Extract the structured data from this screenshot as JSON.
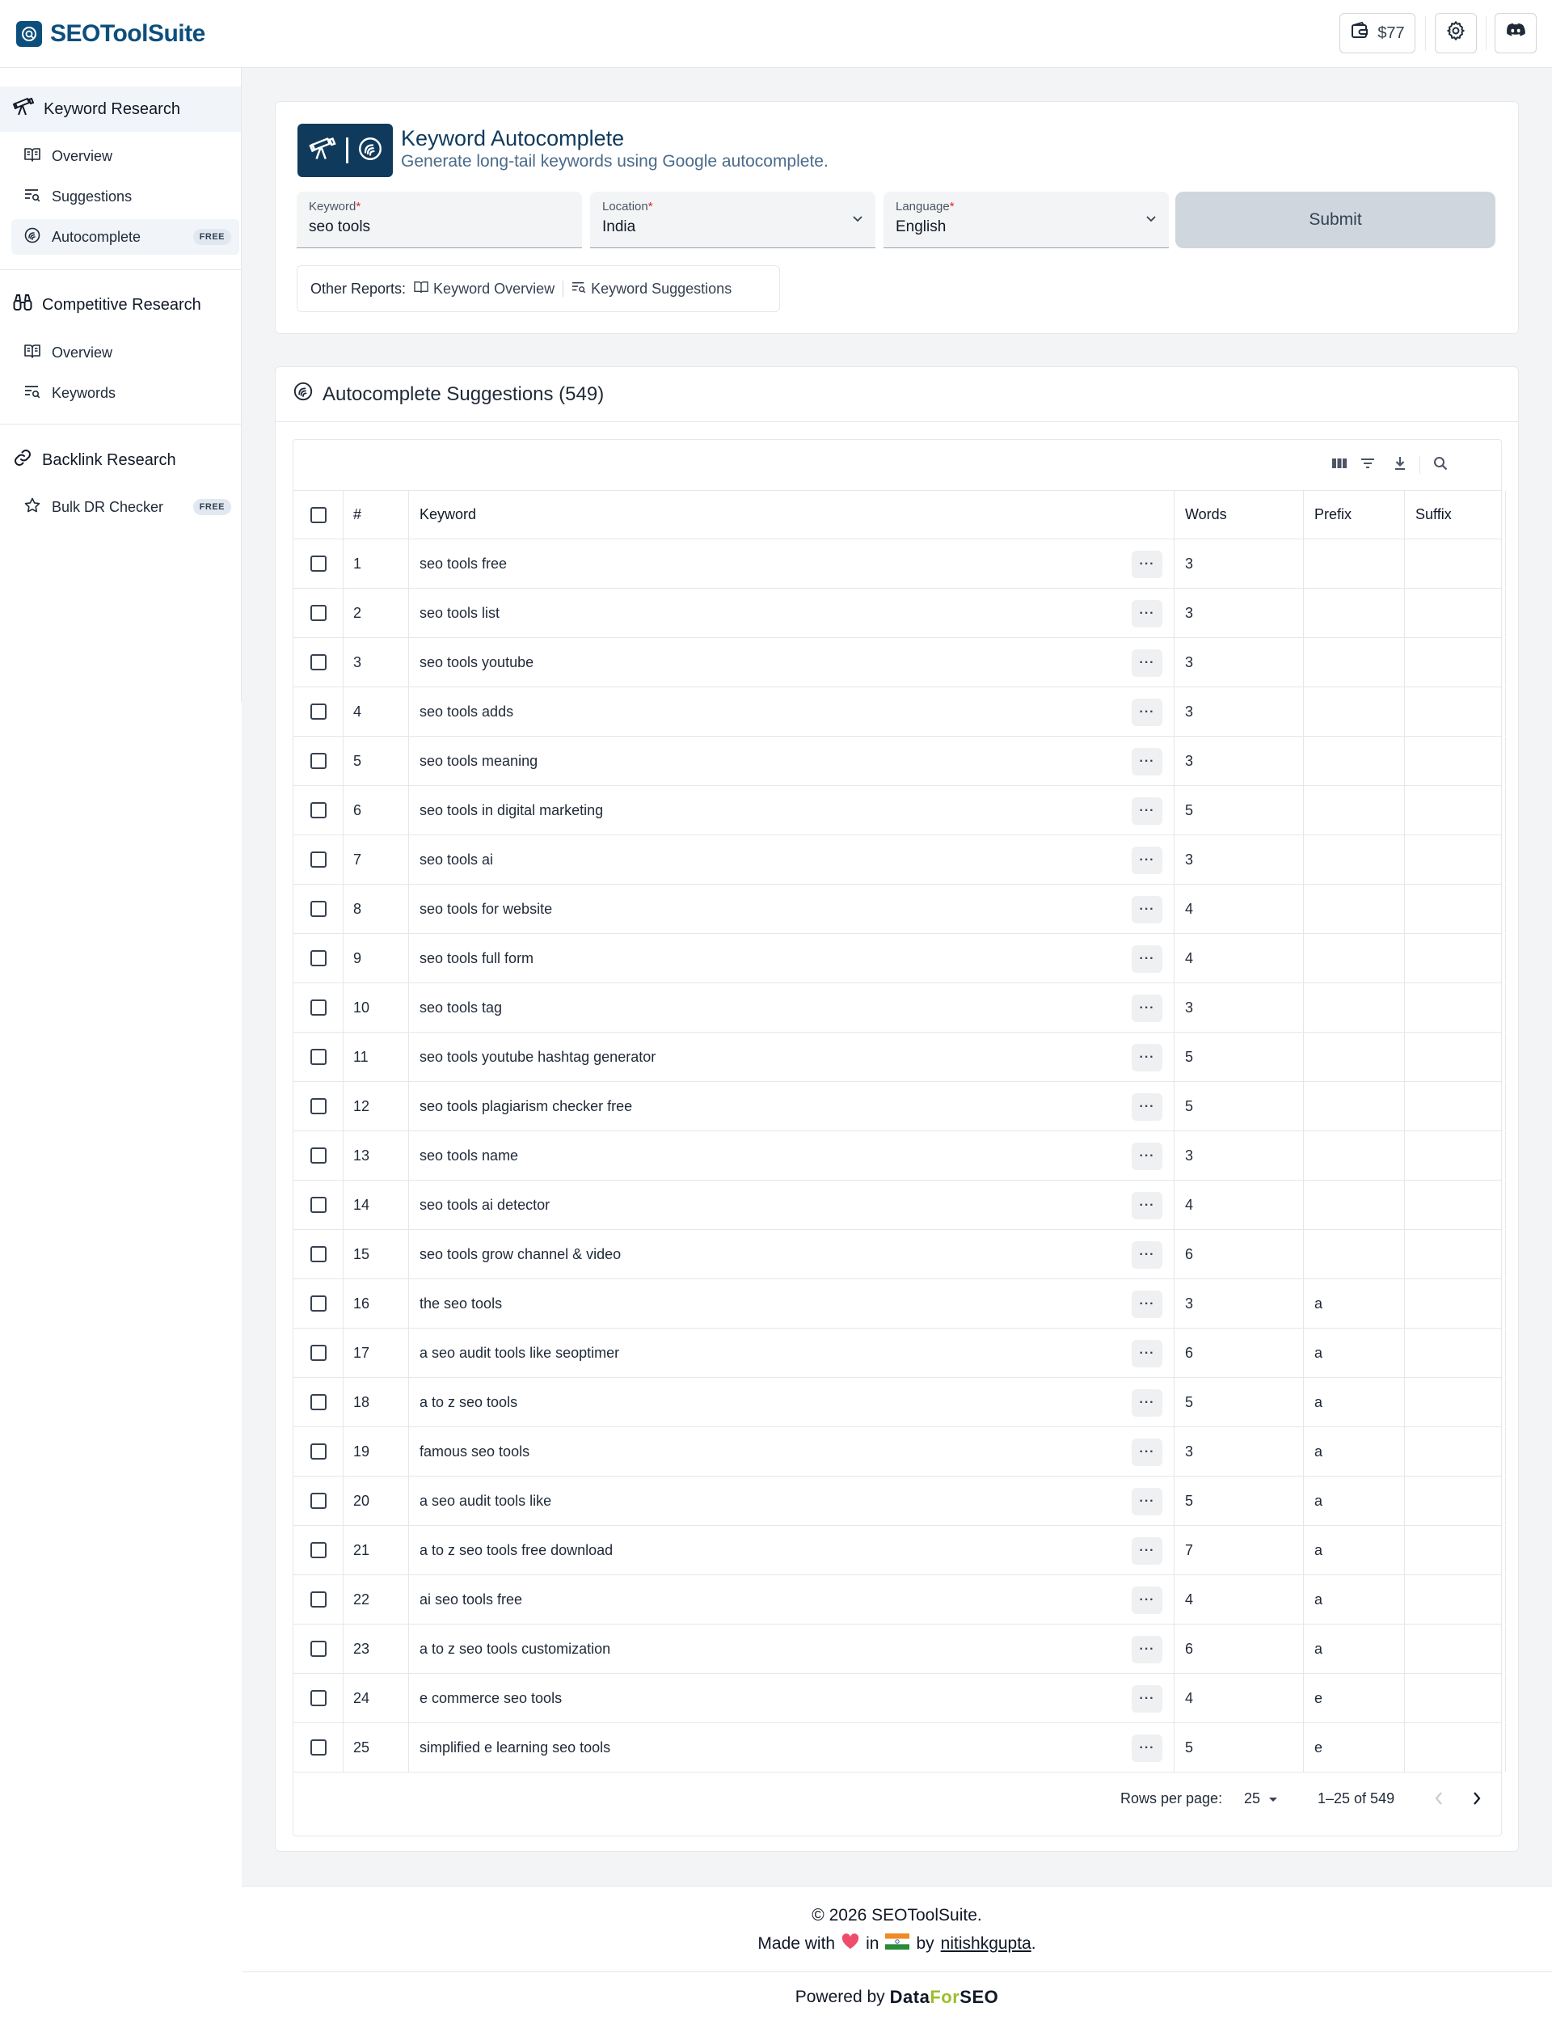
{
  "header": {
    "brand": "SEOToolSuite",
    "wallet_amount": "$77"
  },
  "sidebar": {
    "groups": [
      {
        "label": "Keyword Research",
        "items": [
          {
            "label": "Overview"
          },
          {
            "label": "Suggestions"
          },
          {
            "label": "Autocomplete",
            "badge": "FREE"
          }
        ]
      },
      {
        "label": "Competitive Research",
        "items": [
          {
            "label": "Overview"
          },
          {
            "label": "Keywords"
          }
        ]
      },
      {
        "label": "Backlink Research",
        "items": [
          {
            "label": "Bulk DR Checker",
            "badge": "FREE"
          }
        ]
      }
    ]
  },
  "hero": {
    "title": "Keyword Autocomplete",
    "subtitle": "Generate long-tail keywords using Google autocomplete."
  },
  "form": {
    "keyword_label": "Keyword",
    "keyword_value": "seo tools",
    "location_label": "Location",
    "location_value": "India",
    "language_label": "Language",
    "language_value": "English",
    "required_mark": "*",
    "submit_label": "Submit"
  },
  "other_reports": {
    "label": "Other Reports:",
    "links": [
      "Keyword Overview",
      "Keyword Suggestions"
    ]
  },
  "results": {
    "title": "Autocomplete Suggestions (549)",
    "columns": [
      "#",
      "Keyword",
      "Words",
      "Prefix",
      "Suffix"
    ],
    "rows": [
      {
        "n": "1",
        "keyword": "seo tools free",
        "words": "3",
        "prefix": "",
        "suffix": ""
      },
      {
        "n": "2",
        "keyword": "seo tools list",
        "words": "3",
        "prefix": "",
        "suffix": ""
      },
      {
        "n": "3",
        "keyword": "seo tools youtube",
        "words": "3",
        "prefix": "",
        "suffix": ""
      },
      {
        "n": "4",
        "keyword": "seo tools adds",
        "words": "3",
        "prefix": "",
        "suffix": ""
      },
      {
        "n": "5",
        "keyword": "seo tools meaning",
        "words": "3",
        "prefix": "",
        "suffix": ""
      },
      {
        "n": "6",
        "keyword": "seo tools in digital marketing",
        "words": "5",
        "prefix": "",
        "suffix": ""
      },
      {
        "n": "7",
        "keyword": "seo tools ai",
        "words": "3",
        "prefix": "",
        "suffix": ""
      },
      {
        "n": "8",
        "keyword": "seo tools for website",
        "words": "4",
        "prefix": "",
        "suffix": ""
      },
      {
        "n": "9",
        "keyword": "seo tools full form",
        "words": "4",
        "prefix": "",
        "suffix": ""
      },
      {
        "n": "10",
        "keyword": "seo tools tag",
        "words": "3",
        "prefix": "",
        "suffix": ""
      },
      {
        "n": "11",
        "keyword": "seo tools youtube hashtag generator",
        "words": "5",
        "prefix": "",
        "suffix": ""
      },
      {
        "n": "12",
        "keyword": "seo tools plagiarism checker free",
        "words": "5",
        "prefix": "",
        "suffix": ""
      },
      {
        "n": "13",
        "keyword": "seo tools name",
        "words": "3",
        "prefix": "",
        "suffix": ""
      },
      {
        "n": "14",
        "keyword": "seo tools ai detector",
        "words": "4",
        "prefix": "",
        "suffix": ""
      },
      {
        "n": "15",
        "keyword": "seo tools grow channel & video",
        "words": "6",
        "prefix": "",
        "suffix": ""
      },
      {
        "n": "16",
        "keyword": "the seo tools",
        "words": "3",
        "prefix": "a",
        "suffix": ""
      },
      {
        "n": "17",
        "keyword": "a seo audit tools like seoptimer",
        "words": "6",
        "prefix": "a",
        "suffix": ""
      },
      {
        "n": "18",
        "keyword": "a to z seo tools",
        "words": "5",
        "prefix": "a",
        "suffix": ""
      },
      {
        "n": "19",
        "keyword": "famous seo tools",
        "words": "3",
        "prefix": "a",
        "suffix": ""
      },
      {
        "n": "20",
        "keyword": "a seo audit tools like",
        "words": "5",
        "prefix": "a",
        "suffix": ""
      },
      {
        "n": "21",
        "keyword": "a to z seo tools free download",
        "words": "7",
        "prefix": "a",
        "suffix": ""
      },
      {
        "n": "22",
        "keyword": "ai seo tools free",
        "words": "4",
        "prefix": "a",
        "suffix": ""
      },
      {
        "n": "23",
        "keyword": "a to z seo tools customization",
        "words": "6",
        "prefix": "a",
        "suffix": ""
      },
      {
        "n": "24",
        "keyword": "e commerce seo tools",
        "words": "4",
        "prefix": "e",
        "suffix": ""
      },
      {
        "n": "25",
        "keyword": "simplified e learning seo tools",
        "words": "5",
        "prefix": "e",
        "suffix": ""
      }
    ],
    "more_glyph": "···"
  },
  "pagination": {
    "rows_per_page_label": "Rows per page:",
    "rows_per_page_value": "25",
    "range": "1–25 of 549"
  },
  "footer": {
    "copyright": "© 2026 SEOToolSuite.",
    "made_with": "Made with",
    "in": "in",
    "by": "by",
    "author": "nitishkgupta",
    "period": ".",
    "powered_by": "Powered by",
    "dataforseo_a": "Data",
    "dataforseo_b": "For",
    "dataforseo_c": "SEO"
  },
  "colors": {
    "brand": "#0d4f7c",
    "hero_bg": "#0f3a5c",
    "submit_bg": "#cfd6de",
    "heart": "#ef4c6c",
    "dataforseo_green": "#9bbf2a"
  },
  "icons": [
    "search-logo-icon",
    "wallet-icon",
    "gear-icon",
    "discord-icon",
    "telescope-icon",
    "book-icon",
    "list-search-icon",
    "autocomplete-icon",
    "binoculars-icon",
    "link-icon",
    "star-icon",
    "chevron-down-icon",
    "columns-icon",
    "filter-icon",
    "download-icon",
    "search-icon",
    "chevron-left-icon",
    "chevron-right-icon",
    "heart-icon",
    "india-flag-icon"
  ]
}
